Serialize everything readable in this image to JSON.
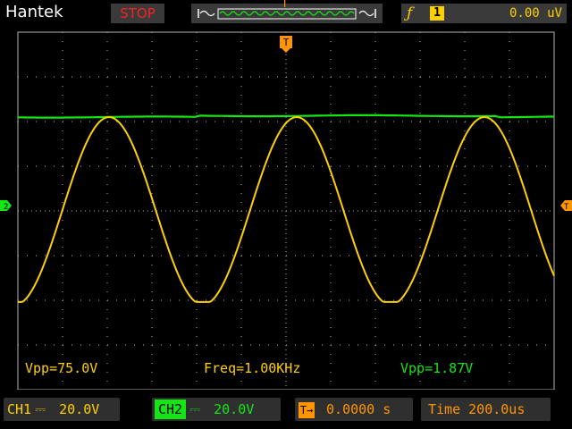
{
  "header": {
    "brand": "Hantek",
    "run_state": "STOP",
    "timebase_marker": "T",
    "trigger_edge_icon": "rising-edge-icon",
    "trigger_source": "1",
    "trigger_level": "0.00 uV"
  },
  "markers": {
    "trigger_top": "T"
  },
  "readouts": {
    "ch1_vpp": "Vpp=75.0V",
    "ch1_freq": "Freq=1.00KHz",
    "ch2_vpp": "Vpp=1.87V"
  },
  "footer": {
    "ch1_label": "CH1",
    "ch1_coupling": "⎓",
    "ch1_scale": "20.0V",
    "ch2_label": "CH2",
    "ch2_coupling": "⎓",
    "ch2_scale": "20.0V",
    "trigger_position": "0.0000 s",
    "timebase": "Time 200.0us"
  },
  "colors": {
    "ch1": "#ffd000",
    "ch2": "#14e614",
    "trigger": "#ff9500",
    "stop": "#ff2020",
    "grid": "#b4b4b4"
  },
  "waveforms": {
    "ch1_period_divisions": 4.2,
    "ch1_peak_division": 2.1,
    "ch2_level_division": 2.1
  }
}
